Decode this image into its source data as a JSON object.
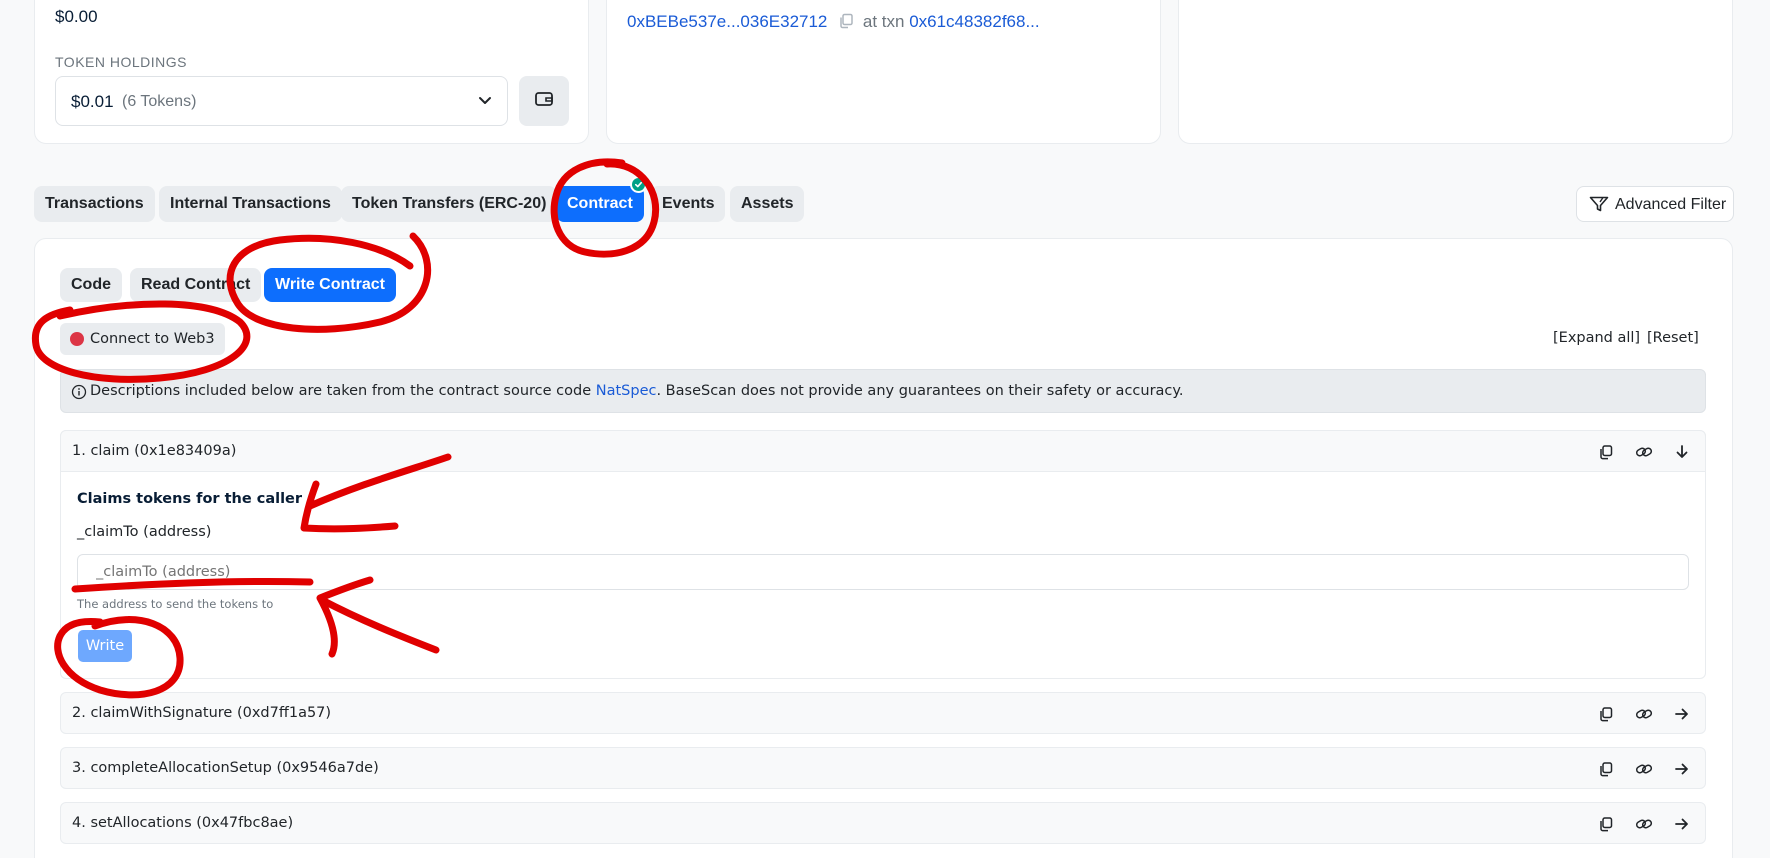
{
  "overview": {
    "eth_value": "$0.00",
    "token_holdings_label": "TOKEN HOLDINGS",
    "token_value": "$0.01",
    "token_count": "(6 Tokens)"
  },
  "creator": {
    "address": "0xBEBe537e...036E32712",
    "at_txn_label": "at txn",
    "txn_hash": "0x61c48382f68..."
  },
  "tabs": [
    {
      "label": "Transactions"
    },
    {
      "label": "Internal Transactions"
    },
    {
      "label": "Token Transfers (ERC-20)"
    },
    {
      "label": "Contract"
    },
    {
      "label": "Events"
    },
    {
      "label": "Assets"
    }
  ],
  "advanced_filter": "Advanced Filter",
  "contract_tabs": [
    {
      "label": "Code"
    },
    {
      "label": "Read Contract"
    },
    {
      "label": "Write Contract"
    }
  ],
  "connect_web3": "Connect to Web3",
  "expand_all": "[Expand all]",
  "reset": "[Reset]",
  "notice": {
    "text_before": "Descriptions included below are taken from the contract source code",
    "link": "NatSpec",
    "text_after": ". BaseScan does not provide any guarantees on their safety or accuracy."
  },
  "functions": [
    {
      "title": "1. claim (0x1e83409a)",
      "expanded": true,
      "description": "Claims tokens for the caller",
      "param_label": "_claimTo (address)",
      "param_placeholder": "_claimTo (address)",
      "param_help": "The address to send the tokens to",
      "write_label": "Write"
    },
    {
      "title": "2. claimWithSignature (0xd7ff1a57)",
      "expanded": false
    },
    {
      "title": "3. completeAllocationSetup (0x9546a7de)",
      "expanded": false
    },
    {
      "title": "4. setAllocations (0x47fbc8ae)",
      "expanded": false
    }
  ],
  "colors": {
    "primary": "#0d6efd",
    "annotation": "#e00000",
    "status_dot": "#dc3545",
    "verified_badge": "#00a186"
  }
}
